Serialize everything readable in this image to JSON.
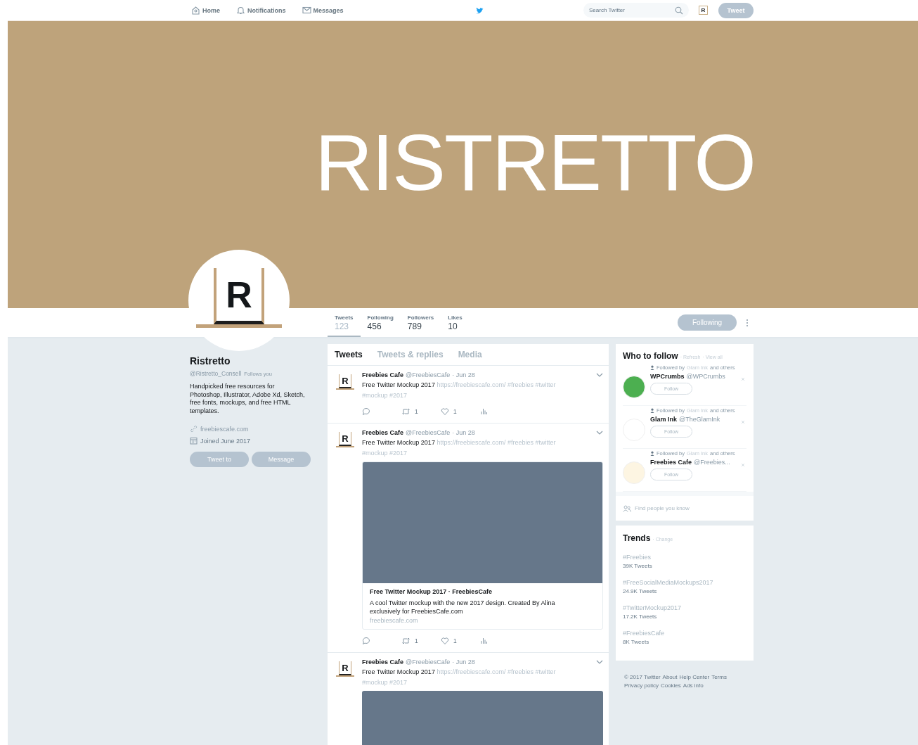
{
  "nav": {
    "items": [
      {
        "label": "Home",
        "selected": false
      },
      {
        "label": "Notifications",
        "selected": false
      },
      {
        "label": "Messages",
        "selected": false
      }
    ],
    "search": {
      "placeholder": "Search Twitter"
    },
    "avatar_letter": "R",
    "tweet_button": "Tweet"
  },
  "banner": {
    "logo": "RISTRETTO"
  },
  "profile": {
    "avatar_letter": "R",
    "name": "Ristretto",
    "handle": "@Ristretto_Consell",
    "follows_you": "Follows you",
    "bio": "Handpicked free resources for Photoshop, Illustrator, Adobe Xd, Sketch, free fonts, mockups, and free HTML templates.",
    "website": "freebiescafe.com",
    "joined": "Joined June 2017",
    "buttons": [
      "Tweet to",
      "Message"
    ]
  },
  "stats": [
    {
      "label": "Tweets",
      "value": "123",
      "selected": true
    },
    {
      "label": "Following",
      "value": "456",
      "selected": false
    },
    {
      "label": "Followers",
      "value": "789",
      "selected": false
    },
    {
      "label": "Likes",
      "value": "10",
      "selected": false
    }
  ],
  "follow_button": "Following",
  "timeline_tabs": [
    {
      "label": "Tweets",
      "selected": true
    },
    {
      "label": "Tweets & replies",
      "selected": false
    },
    {
      "label": "Media",
      "selected": false
    }
  ],
  "tweets": [
    {
      "avatar_letter": "R",
      "name": "Freebies Cafe",
      "handle": "@FreebiesCafe",
      "date": "· Jun 28",
      "text": "Free Twitter Mockup 2017",
      "link": "https://freebiescafe.com/",
      "tags": [
        "#freebies",
        "#twitter",
        "#mockup",
        "#2017"
      ],
      "media": false,
      "actions": {
        "retweets": "1",
        "likes": "1"
      }
    },
    {
      "avatar_letter": "R",
      "name": "Freebies Cafe",
      "handle": "@FreebiesCafe",
      "date": "· Jun 28",
      "text": "Free Twitter Mockup 2017",
      "link": "https://freebiescafe.com/",
      "tags": [
        "#freebies",
        "#twitter",
        "#mockup",
        "#2017"
      ],
      "media": true,
      "card": {
        "title": "Free Twitter Mockup 2017 · FreebiesCafe",
        "description": "A cool Twitter mockup with the new 2017 design. Created By Alina exclusively for FreebiesCafe.com",
        "url": "freebiescafe.com"
      },
      "actions": {
        "retweets": "1",
        "likes": "1"
      }
    },
    {
      "avatar_letter": "R",
      "name": "Freebies Cafe",
      "handle": "@FreebiesCafe",
      "date": "· Jun 28",
      "text": "Free Twitter Mockup 2017",
      "link": "https://freebiescafe.com/",
      "tags": [
        "#freebies",
        "#twitter",
        "#mockup",
        "#2017"
      ],
      "media": true
    }
  ],
  "who_to_follow": {
    "title": "Who to follow",
    "refresh": "· Refresh",
    "view_all": "· View all",
    "suggestions": [
      {
        "followed_by": "Followed by",
        "friend": "Glam Ink",
        "others": "and others",
        "name": "WPCrumbs",
        "handle": "@WPCrumbs",
        "button": "Follow",
        "color": "#4caf50"
      },
      {
        "followed_by": "Followed by",
        "friend": "Glam Ink",
        "others": "and others",
        "name": "Glam Ink",
        "handle": "@TheGlamInk",
        "button": "Follow",
        "color": "#ffffff"
      },
      {
        "followed_by": "Followed by",
        "friend": "Glam Ink",
        "others": "and others",
        "name": "Freebies Cafe",
        "handle": "@Freebies...",
        "button": "Follow",
        "color": "#fdf5e2"
      }
    ],
    "find_people": "Find people you know"
  },
  "trends": {
    "title": "Trends",
    "change": "· Change",
    "items": [
      {
        "tag": "#Freebies",
        "count": "39K Tweets"
      },
      {
        "tag": "#FreeSocialMediaMockups2017",
        "count": "24.9K Tweets"
      },
      {
        "tag": "#TwitterMockup2017",
        "count": "17.2K Tweets"
      },
      {
        "tag": "#FreebiesCafe",
        "count": "8K Tweets"
      }
    ]
  },
  "footer": [
    [
      "© 2017 Twitter",
      "About",
      "Help Center",
      "Terms"
    ],
    [
      "Privacy policy",
      "Cookies",
      "Ads info"
    ]
  ]
}
